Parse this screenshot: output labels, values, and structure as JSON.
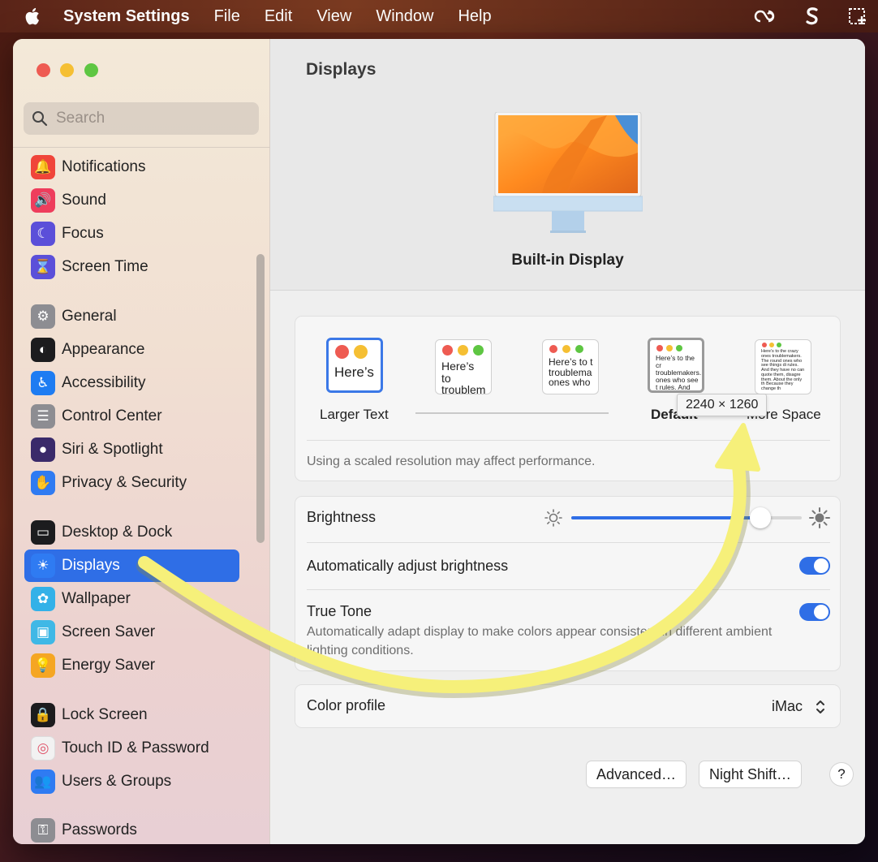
{
  "menubar": {
    "app_name": "System Settings",
    "menus": [
      "File",
      "Edit",
      "View",
      "Window",
      "Help"
    ]
  },
  "search": {
    "placeholder": "Search"
  },
  "sidebar": {
    "items": [
      {
        "label": "Notifications",
        "icon": "bell-icon",
        "color": "#f0453a"
      },
      {
        "label": "Sound",
        "icon": "speaker-icon",
        "color": "#ee3d5c"
      },
      {
        "label": "Focus",
        "icon": "moon-icon",
        "color": "#5b4fd9"
      },
      {
        "label": "Screen Time",
        "icon": "hourglass-icon",
        "color": "#5b4fd9"
      },
      {
        "label": "General",
        "icon": "gear-icon",
        "color": "#8d8d92"
      },
      {
        "label": "Appearance",
        "icon": "appearance-icon",
        "color": "#1c1c1e"
      },
      {
        "label": "Accessibility",
        "icon": "accessibility-icon",
        "color": "#1e7cf2"
      },
      {
        "label": "Control Center",
        "icon": "control-center-icon",
        "color": "#8d8d92"
      },
      {
        "label": "Siri & Spotlight",
        "icon": "siri-icon",
        "color": "#3a2a6a"
      },
      {
        "label": "Privacy & Security",
        "icon": "hand-icon",
        "color": "#2f7bf2"
      },
      {
        "label": "Desktop & Dock",
        "icon": "dock-icon",
        "color": "#1c1c1e"
      },
      {
        "label": "Displays",
        "icon": "sun-icon",
        "color": "#2f7bf2"
      },
      {
        "label": "Wallpaper",
        "icon": "flower-icon",
        "color": "#33b1e8"
      },
      {
        "label": "Screen Saver",
        "icon": "screensaver-icon",
        "color": "#3fb8e6"
      },
      {
        "label": "Energy Saver",
        "icon": "bulb-icon",
        "color": "#f5a623"
      },
      {
        "label": "Lock Screen",
        "icon": "lock-icon",
        "color": "#1c1c1e"
      },
      {
        "label": "Touch ID & Password",
        "icon": "fingerprint-icon",
        "color": "#f2f2f2"
      },
      {
        "label": "Users & Groups",
        "icon": "users-icon",
        "color": "#2f7bf2"
      },
      {
        "label": "Passwords",
        "icon": "key-icon",
        "color": "#8d8d92"
      }
    ],
    "active": "Displays"
  },
  "main": {
    "title": "Displays",
    "display_name": "Built-in Display",
    "resolution": {
      "options": [
        {
          "preview": "Here’s",
          "label": "Larger Text"
        },
        {
          "preview": "Here’s to troublem",
          "label": ""
        },
        {
          "preview": "Here’s to t troublema ones who",
          "label": ""
        },
        {
          "preview": "Here’s to the cr troublemakers. ones who see t rules. And they",
          "label": "Default"
        },
        {
          "preview": "Here’s to the crazy ones troublemakers. The round ones who see things di rules. And they have no can quote them, disagre them. About the only th Because they change th",
          "label": "More Space"
        }
      ],
      "selected_index": 3,
      "tooltip": "2240 × 1260",
      "note": "Using a scaled resolution may affect performance."
    },
    "brightness": {
      "label": "Brightness",
      "value_fraction": 0.82,
      "auto_label": "Automatically adjust brightness",
      "auto_on": true,
      "true_tone_label": "True Tone",
      "true_tone_desc": "Automatically adapt display to make colors appear consistent in different ambient lighting conditions.",
      "true_tone_on": true
    },
    "color_profile": {
      "label": "Color profile",
      "value": "iMac"
    },
    "buttons": {
      "advanced": "Advanced…",
      "night_shift": "Night Shift…",
      "help": "?"
    }
  },
  "colors": {
    "accent": "#2f6ee6",
    "annotation_arrow": "#f6f07a"
  }
}
